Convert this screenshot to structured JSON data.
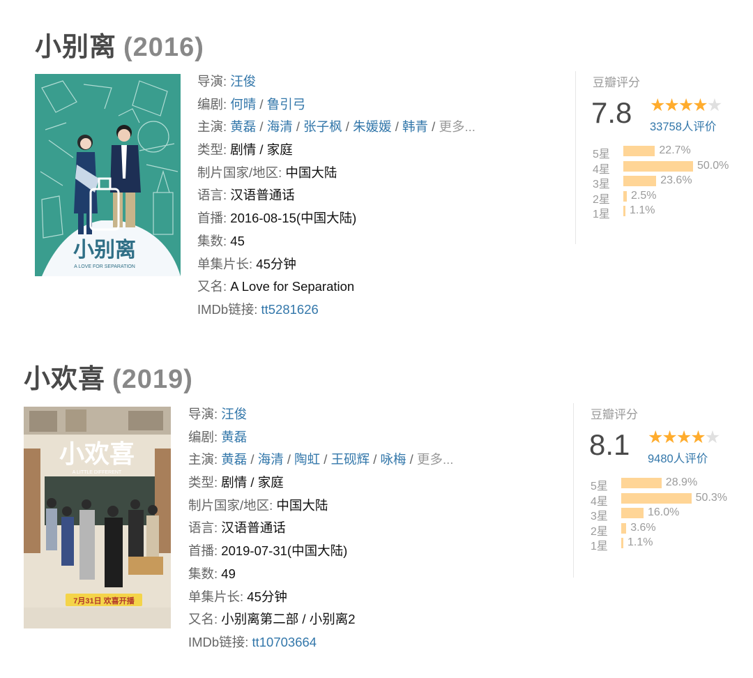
{
  "movies": [
    {
      "title": "小别离",
      "year": "(2016)",
      "poster": {
        "title_glyph": "小别离",
        "subtitle": "A LOVE FOR SEPARATION",
        "bg": "#3a9d8e"
      },
      "info": {
        "director_label": "导演:",
        "director": "汪俊",
        "writer_label": "编剧:",
        "writers": [
          "何晴",
          "鲁引弓"
        ],
        "cast_label": "主演:",
        "cast": [
          "黄磊",
          "海清",
          "张子枫",
          "朱媛媛",
          "韩青"
        ],
        "more": "更多...",
        "genre_label": "类型:",
        "genre": "剧情 / 家庭",
        "country_label": "制片国家/地区:",
        "country": "中国大陆",
        "language_label": "语言:",
        "language": "汉语普通话",
        "premiere_label": "首播:",
        "premiere": "2016-08-15(中国大陆)",
        "episodes_label": "集数:",
        "episodes": "45",
        "runtime_label": "单集片长:",
        "runtime": "45分钟",
        "aka_label": "又名:",
        "aka": "A Love for Separation",
        "imdb_label": "IMDb链接:",
        "imdb": "tt5281626"
      },
      "rating": {
        "label": "豆瓣评分",
        "score": "7.8",
        "stars_filled": 4,
        "stars_total": 5,
        "votes": "33758人评价",
        "distribution": [
          {
            "label": "5星",
            "pct": "22.7%",
            "value": 22.7
          },
          {
            "label": "4星",
            "pct": "50.0%",
            "value": 50.0
          },
          {
            "label": "3星",
            "pct": "23.6%",
            "value": 23.6
          },
          {
            "label": "2星",
            "pct": "2.5%",
            "value": 2.5
          },
          {
            "label": "1星",
            "pct": "1.1%",
            "value": 1.1
          }
        ]
      }
    },
    {
      "title": "小欢喜",
      "year": "(2019)",
      "poster": {
        "title_glyph": "小欢喜",
        "subtitle": "A LITTLE DIFFERENT",
        "bg": "#e9e1d2",
        "banner": "7月31日 欢喜开播"
      },
      "info": {
        "director_label": "导演:",
        "director": "汪俊",
        "writer_label": "编剧:",
        "writers": [
          "黄磊"
        ],
        "cast_label": "主演:",
        "cast": [
          "黄磊",
          "海清",
          "陶虹",
          "王砚辉",
          "咏梅"
        ],
        "more": "更多...",
        "genre_label": "类型:",
        "genre": "剧情 / 家庭",
        "country_label": "制片国家/地区:",
        "country": "中国大陆",
        "language_label": "语言:",
        "language": "汉语普通话",
        "premiere_label": "首播:",
        "premiere": "2019-07-31(中国大陆)",
        "episodes_label": "集数:",
        "episodes": "49",
        "runtime_label": "单集片长:",
        "runtime": "45分钟",
        "aka_label": "又名:",
        "aka": "小别离第二部 / 小别离2",
        "imdb_label": "IMDb链接:",
        "imdb": "tt10703664"
      },
      "rating": {
        "label": "豆瓣评分",
        "score": "8.1",
        "stars_filled": 4,
        "stars_total": 5,
        "votes": "9480人评价",
        "distribution": [
          {
            "label": "5星",
            "pct": "28.9%",
            "value": 28.9
          },
          {
            "label": "4星",
            "pct": "50.3%",
            "value": 50.3
          },
          {
            "label": "3星",
            "pct": "16.0%",
            "value": 16.0
          },
          {
            "label": "2星",
            "pct": "3.6%",
            "value": 3.6
          },
          {
            "label": "1星",
            "pct": "1.1%",
            "value": 1.1
          }
        ]
      }
    }
  ],
  "colors": {
    "link": "#3377aa",
    "star": "#ffac2d",
    "bar": "#ffd596",
    "label": "#666666"
  }
}
